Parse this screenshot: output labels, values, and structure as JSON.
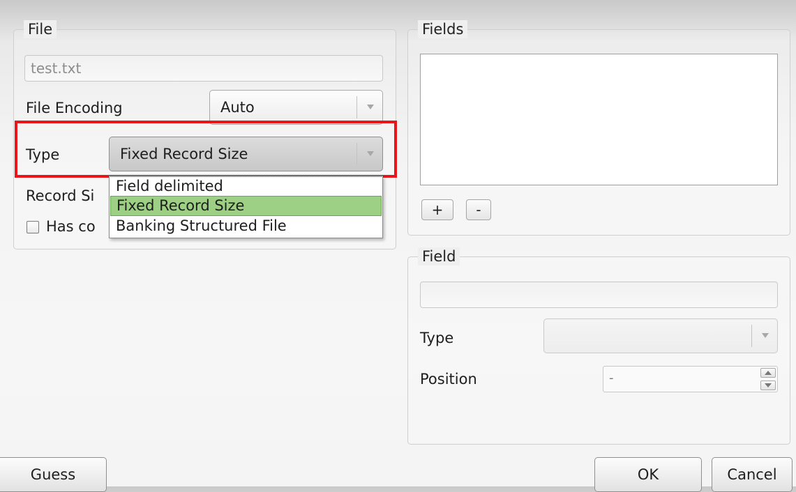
{
  "file_group": {
    "title": "File",
    "filename_value": "test.txt",
    "encoding_label": "File Encoding",
    "encoding_value": "Auto",
    "type_label": "Type",
    "type_value": "Fixed Record Size",
    "record_size_label": "Record Si",
    "has_checkbox_label": "Has co",
    "type_options": [
      {
        "label": "Field delimited",
        "selected": false
      },
      {
        "label": "Fixed Record Size",
        "selected": true
      },
      {
        "label": "Banking Structured File",
        "selected": false
      }
    ]
  },
  "fields_group": {
    "title": "Fields",
    "add_label": "+",
    "remove_label": "-"
  },
  "field_group": {
    "title": "Field",
    "name_value": "",
    "type_label": "Type",
    "type_value": "",
    "position_label": "Position",
    "position_value": "-"
  },
  "buttons": {
    "guess": "Guess",
    "ok": "OK",
    "cancel": "Cancel"
  },
  "colors": {
    "highlight": "#e8151b",
    "selected_option": "#9dd084"
  }
}
